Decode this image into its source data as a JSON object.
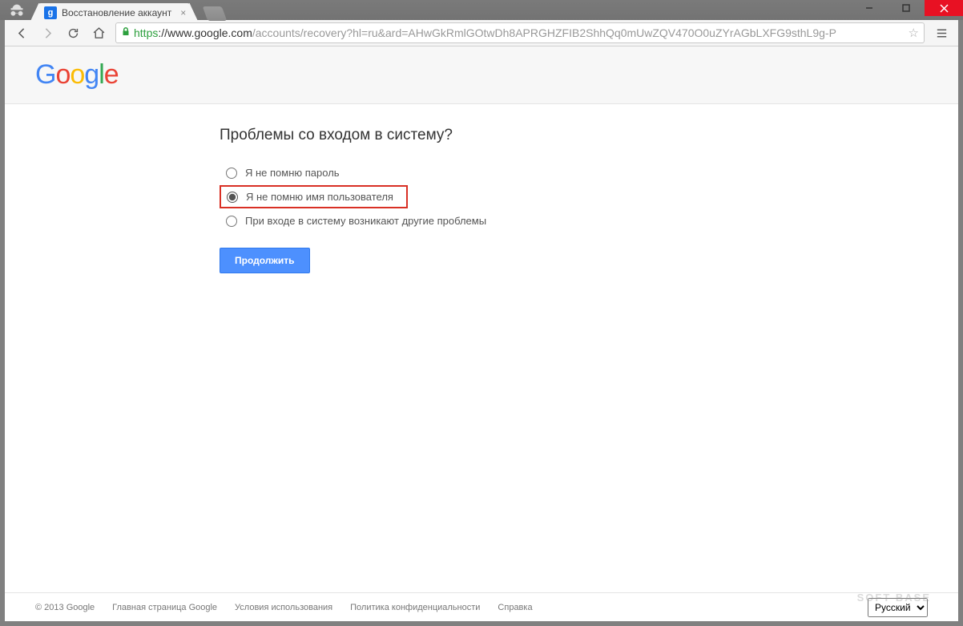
{
  "browser": {
    "tab_title": "Восстановление аккаунт",
    "url_https": "https",
    "url_host": "://www.google.com",
    "url_path": "/accounts/recovery?hl=ru&ard=AHwGkRmlGOtwDh8APRGHZFIB2ShhQq0mUwZQV470O0uZYrAGbLXFG9sthL9g-P"
  },
  "logo": {
    "g1": "G",
    "o1": "o",
    "o2": "o",
    "g2": "g",
    "l": "l",
    "e": "e"
  },
  "page": {
    "heading": "Проблемы со входом в систему?",
    "options": [
      "Я не помню пароль",
      "Я не помню имя пользователя",
      "При входе в систему возникают другие проблемы"
    ],
    "continue_label": "Продолжить"
  },
  "footer": {
    "copyright": "© 2013 Google",
    "links": [
      "Главная страница Google",
      "Условия использования",
      "Политика конфиденциальности",
      "Справка"
    ],
    "language": "Русский"
  },
  "watermark": "SOFT   BASE"
}
